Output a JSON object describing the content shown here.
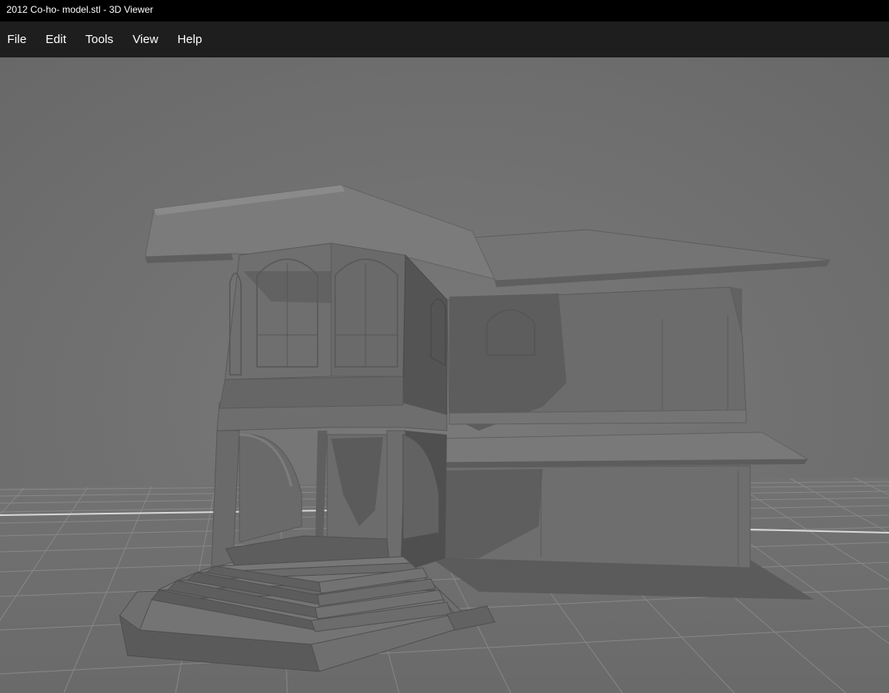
{
  "window": {
    "title": "2012 Co-ho- model.stl - 3D Viewer"
  },
  "menu": {
    "items": [
      {
        "label": "File"
      },
      {
        "label": "Edit"
      },
      {
        "label": "Tools"
      },
      {
        "label": "View"
      },
      {
        "label": "Help"
      }
    ]
  },
  "viewport": {
    "content": "3D model of a two-storey house on a grid floor",
    "background_color": "#6e6e6e",
    "model_color": "#6a6a6a",
    "grid_color": "#8a8a8a"
  }
}
